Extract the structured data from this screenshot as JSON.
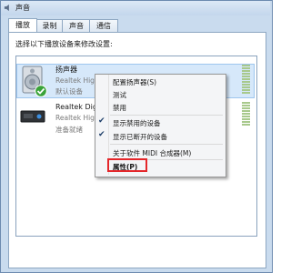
{
  "window": {
    "title": "声音"
  },
  "tabs": [
    {
      "label": "播放"
    },
    {
      "label": "录制"
    },
    {
      "label": "声音"
    },
    {
      "label": "通信"
    }
  ],
  "instruction": "选择以下播放设备来修改设置:",
  "devices": [
    {
      "name": "扬声器",
      "line2": "Realtek Hig",
      "status": "默认设备"
    },
    {
      "name": "Realtek Dig",
      "line2": "Realtek Hig",
      "status": "准备就绪"
    }
  ],
  "context_menu": {
    "items": [
      {
        "label": "配置扬声器(S)"
      },
      {
        "label": "测试"
      },
      {
        "label": "禁用"
      },
      {
        "label": "显示禁用的设备",
        "checked": true
      },
      {
        "label": "显示已断开的设备",
        "checked": true
      },
      {
        "label": "关于软件 MIDI 合成器(M)"
      },
      {
        "label": "属性(P)"
      }
    ]
  },
  "colors": {
    "accent_highlight": "#e4262a",
    "selection": "#d6e8fa",
    "window_frame": "#c9dbee"
  }
}
